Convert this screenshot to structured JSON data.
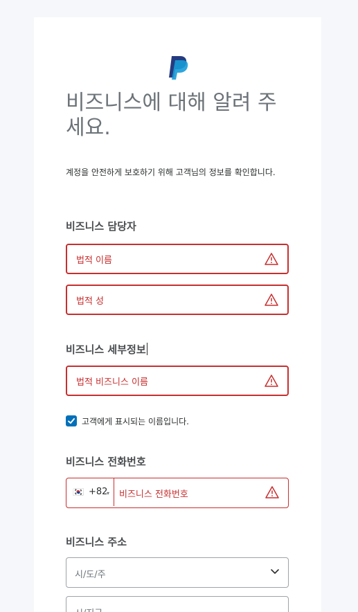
{
  "page": {
    "title": "비즈니스에 대해 알려 주세요.",
    "description": "계정을 안전하게 보호하기 위해 고객님의 정보를 확인합니다."
  },
  "contact_section": {
    "heading": "비즈니스 담당자",
    "first_name_label": "법적 이름",
    "last_name_label": "법적 성"
  },
  "details_section": {
    "heading": "비즈니스 세부정보",
    "legal_name_label": "법적 비즈니스 이름",
    "display_name_checkbox": "고객에게 표시되는 이름입니다.",
    "display_name_checked": true
  },
  "phone_section": {
    "heading": "비즈니스 전화번호",
    "flag": "🇰🇷",
    "country_code": "+82",
    "caret": "▾",
    "phone_label": "비즈니스 전화번호"
  },
  "address_section": {
    "heading": "비즈니스 주소",
    "state_placeholder": "시/도/주",
    "city_placeholder": "시/지구"
  },
  "colors": {
    "error": "#c72e2e",
    "brand_dark": "#253b80",
    "brand_light": "#179bd7",
    "checkbox": "#0070ba"
  }
}
